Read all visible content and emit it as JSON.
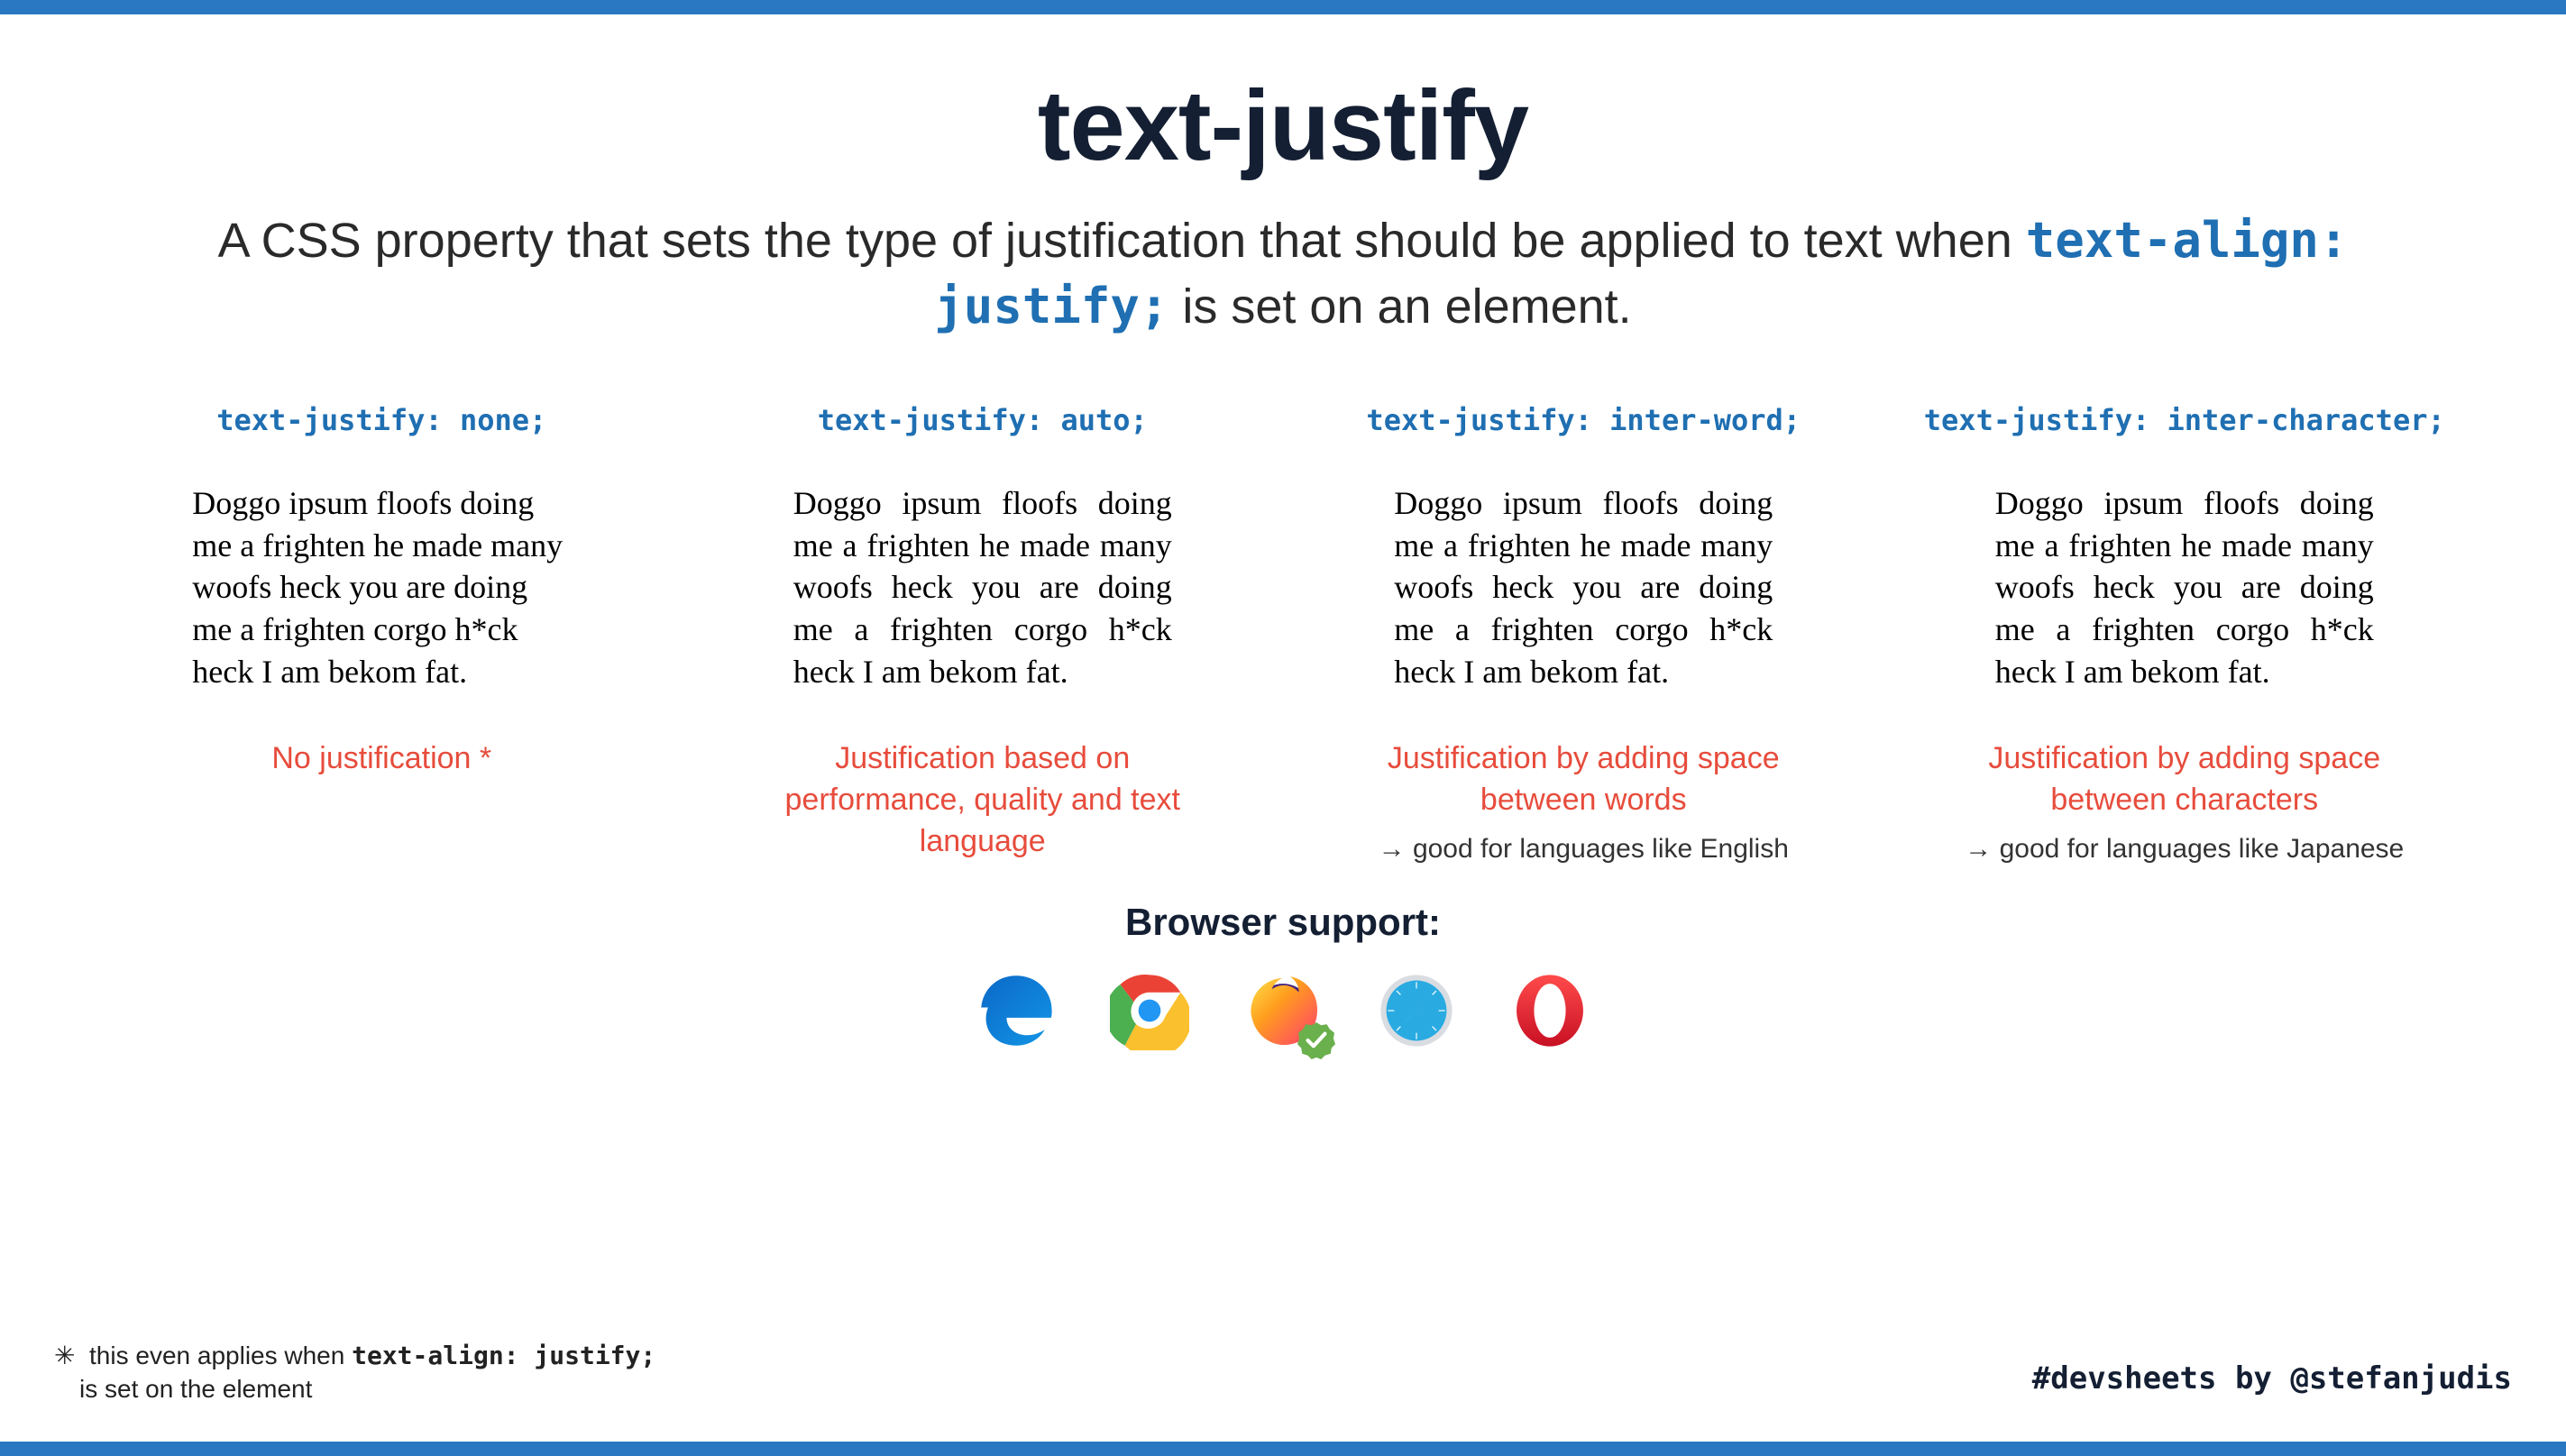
{
  "title": "text-justify",
  "subtitle_pre": "A CSS property that sets the type of justification that should be applied to text when ",
  "subtitle_code": "text-align: justify;",
  "subtitle_post": " is set on an element.",
  "sample_text": "Doggo ipsum floofs doing me a frighten he made many woofs heck you are doing me a frighten corgo h*ck heck I am bekom fat.",
  "columns": [
    {
      "header": "text-justify: none;",
      "caption": "No justification *",
      "hint": ""
    },
    {
      "header": "text-justify: auto;",
      "caption": "Justification based on performance, quality and text language",
      "hint": ""
    },
    {
      "header": "text-justify: inter-word;",
      "caption": "Justification by adding space between words",
      "hint": "good for languages like English"
    },
    {
      "header": "text-justify: inter-character;",
      "caption": "Justification by adding space between characters",
      "hint": "good for languages like Japanese"
    }
  ],
  "support_title": "Browser support:",
  "footnote_marker": "✳",
  "footnote_pre": "this even applies when ",
  "footnote_code": "text-align: justify;",
  "footnote_post": "is set on the element",
  "credit": "#devsheets by @stefanjudis",
  "browsers": [
    "edge",
    "chrome",
    "firefox",
    "safari",
    "opera"
  ],
  "firefox_full_support": true,
  "colors": {
    "accent_blue": "#1f6fb2",
    "border_blue": "#2a77c2",
    "red": "#e74c3c",
    "dark": "#141f33"
  }
}
